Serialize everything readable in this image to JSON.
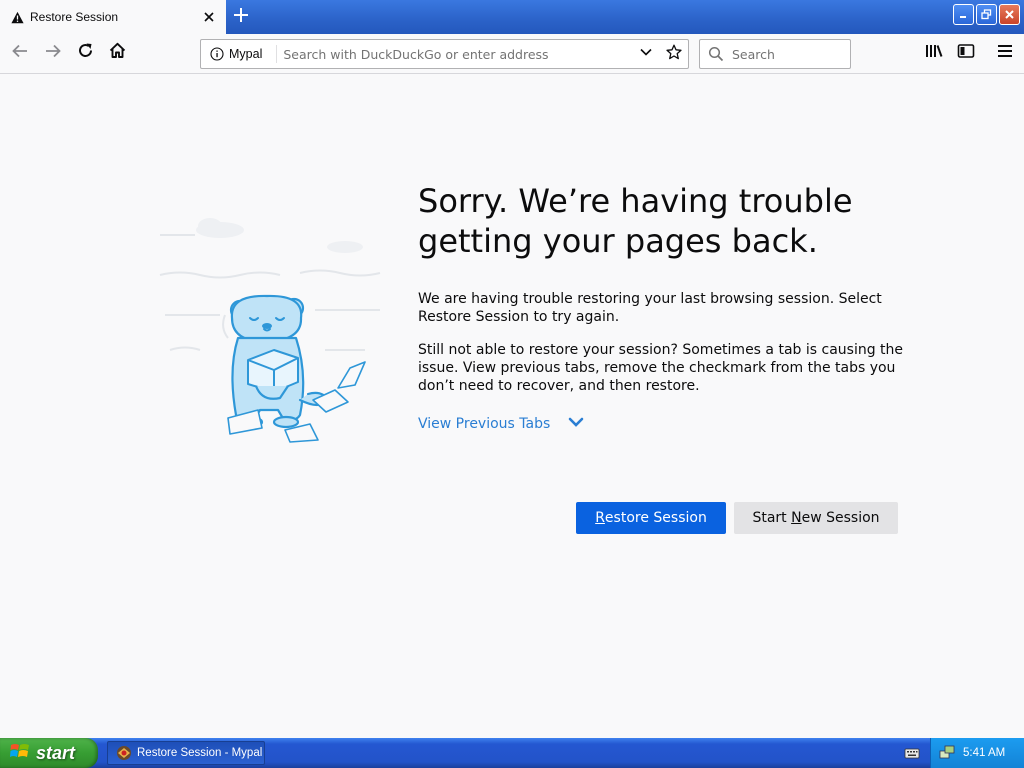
{
  "tab": {
    "title": "Restore Session",
    "icon": "warning-icon",
    "close_icon": "close-icon"
  },
  "toolbar": {
    "new_tab_icon": "plus-icon",
    "back_icon": "back-arrow-icon",
    "forward_icon": "forward-arrow-icon",
    "reload_icon": "reload-icon",
    "home_icon": "home-icon",
    "library_icon": "library-icon",
    "sidebar_icon": "sidebar-icon",
    "menu_icon": "hamburger-menu-icon"
  },
  "urlbar": {
    "identity": "Mypal",
    "placeholder": "Search with DuckDuckGo or enter address",
    "value": ""
  },
  "searchbar": {
    "placeholder": "Search",
    "value": ""
  },
  "page": {
    "heading_line1": "Sorry. We’re having trouble",
    "heading_line2": "getting your pages back.",
    "para1": "We are having trouble restoring your last browsing session. Select Restore Session to try again.",
    "para2": "Still not able to restore your session? Sometimes a tab is causing the issue. View previous tabs, remove the checkmark from the tabs you don’t need to recover, and then restore.",
    "view_tabs": "View Previous Tabs",
    "restore_btn_access": "R",
    "restore_btn_rest": "estore Session",
    "new_btn_pre": "Start ",
    "new_btn_access": "N",
    "new_btn_rest": "ew Session"
  },
  "taskbar": {
    "start_label": "start",
    "task_label": "Restore Session - Mypal",
    "clock": "5:41 AM"
  },
  "colors": {
    "accent": "#0a62e0",
    "link": "#2a7ed3",
    "illustration": "#3fa9e6"
  }
}
